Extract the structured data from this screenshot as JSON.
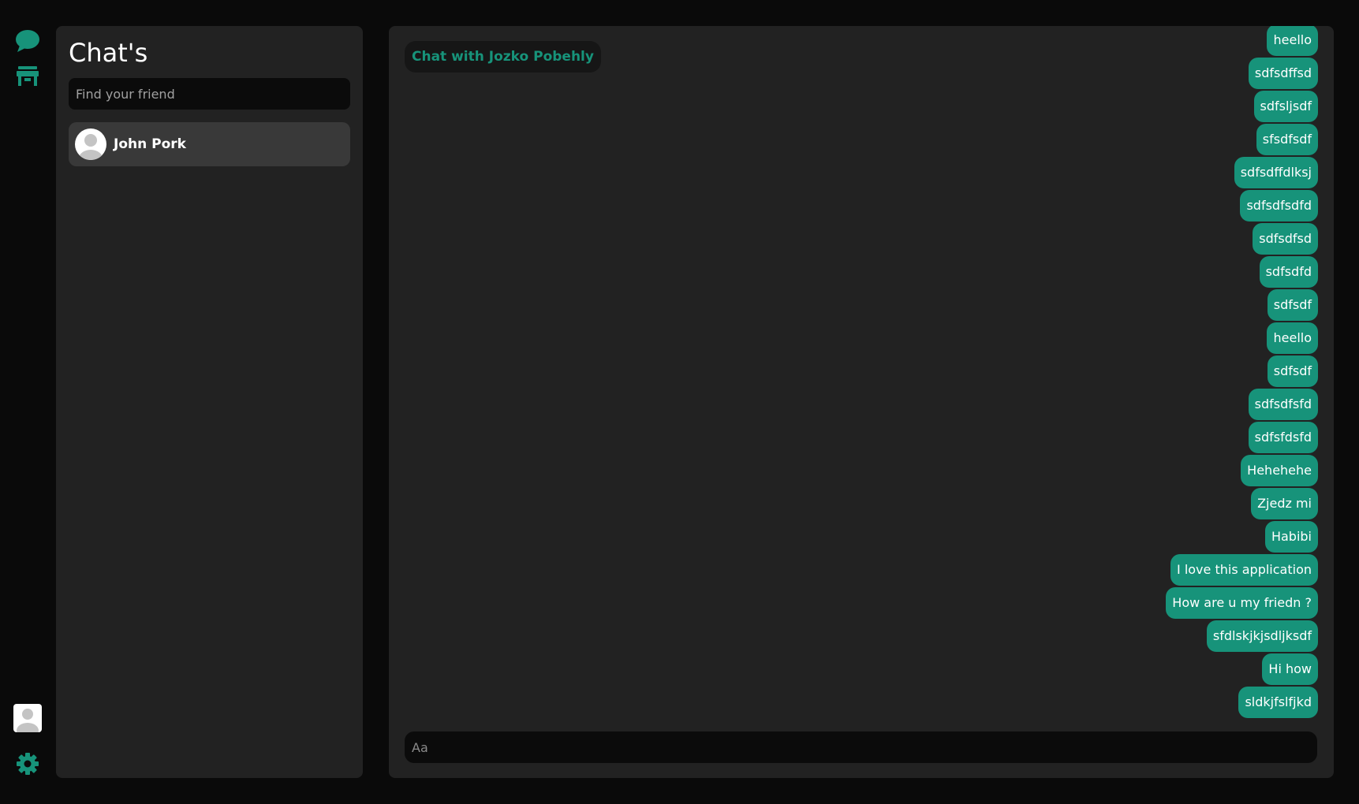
{
  "colors": {
    "accent": "#17937a",
    "background": "#0a0a0a",
    "panel": "#222222",
    "input": "#0b0b0b",
    "selected_item": "#393939"
  },
  "rail": {
    "icons": [
      "chat-bubble-icon",
      "storefront-icon",
      "user-avatar-icon",
      "gear-icon"
    ]
  },
  "chats": {
    "title": "Chat's",
    "search_placeholder": "Find your friend",
    "friends": [
      {
        "name": "John Pork",
        "selected": true
      }
    ]
  },
  "chat": {
    "header": "Chat with Jozko Pobehly",
    "composer_placeholder": "Aa",
    "messages": [
      "heello",
      "sdfsdffsd",
      "sdfsljsdf",
      "sfsdfsdf",
      "sdfsdffdlksj",
      "sdfsdfsdfd",
      "sdfsdfsd",
      "sdfsdfd",
      "sdfsdf",
      "heello",
      "sdfsdf",
      "sdfsdfsfd",
      "sdfsfdsfd",
      "Hehehehe",
      "Zjedz mi",
      "Habibi",
      "I love this application",
      "How are u my friedn ?",
      "sfdlskjkjsdljksdf",
      "Hi how",
      "sldkjfslfjkd"
    ]
  }
}
